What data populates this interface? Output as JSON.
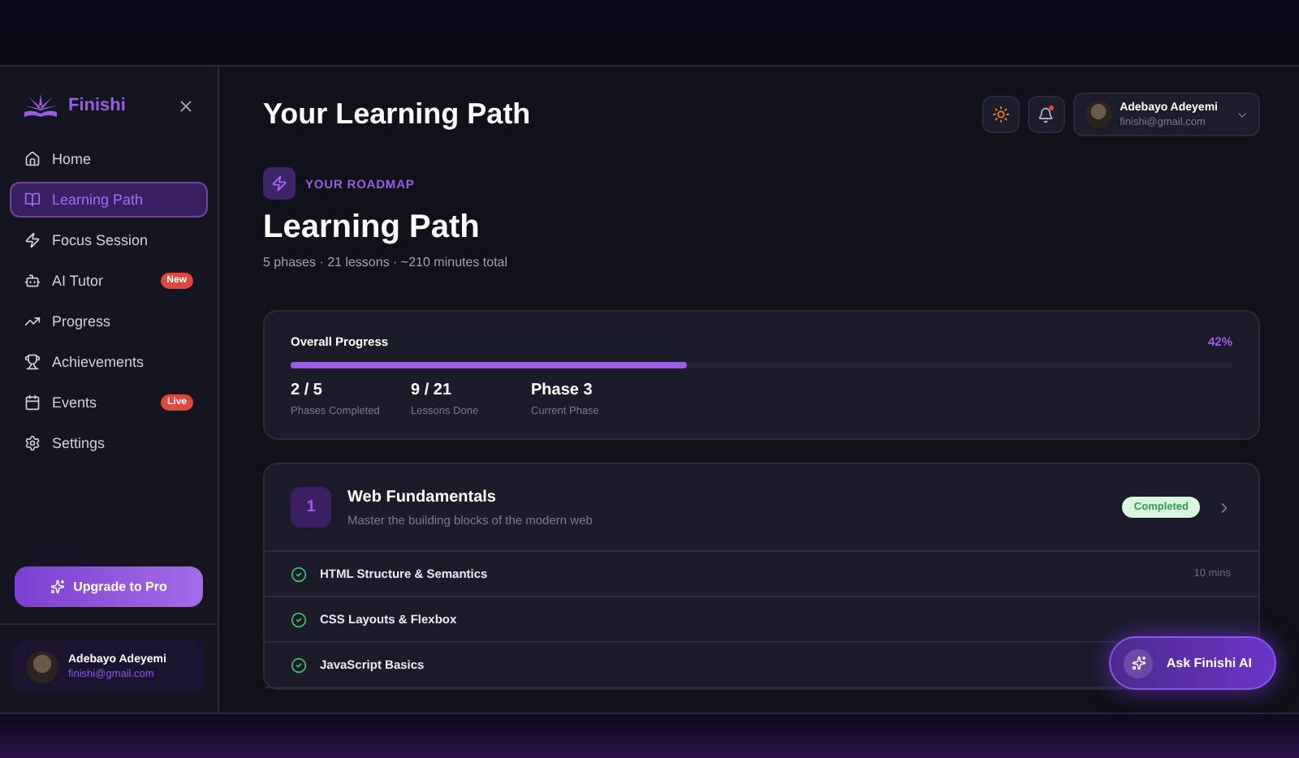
{
  "sidebar": {
    "brand": "Finishi",
    "items": [
      {
        "label": "Home",
        "selected": false
      },
      {
        "label": "Learning Path",
        "selected": true
      },
      {
        "label": "Focus Session",
        "selected": false
      },
      {
        "label": "AI Tutor",
        "selected": false,
        "badge": "New"
      },
      {
        "label": "Progress",
        "selected": false
      },
      {
        "label": "Achievements",
        "selected": false
      },
      {
        "label": "Events",
        "selected": false,
        "badge": "Live"
      },
      {
        "label": "Settings",
        "selected": false
      }
    ],
    "upgrade": "Upgrade to Pro",
    "user": {
      "name": "Adebayo Adeyemi",
      "email": "finishi@gmail.com"
    }
  },
  "header": {
    "title": "Your Learning Path",
    "notification_dot": true,
    "user": {
      "name": "Adebayo Adeyemi",
      "email": "finishi@gmail.com"
    }
  },
  "roadmap": {
    "eyebrow": "YOUR ROADMAP",
    "title": "Learning Path",
    "summary": "5 phases · 21 lessons · ~210 minutes total"
  },
  "progress": {
    "label": "Overall Progress",
    "percent": "42%",
    "level": 0.42,
    "stats": [
      {
        "value": "2 / 5",
        "label": "Phases Completed"
      },
      {
        "value": "9 / 21",
        "label": "Lessons Done"
      },
      {
        "value": "Phase 3",
        "label": "Current Phase"
      }
    ]
  },
  "phase": {
    "number": "1",
    "title": "Web Fundamentals",
    "subtitle": "Master the building blocks of the modern web",
    "status": "Completed",
    "lessons": [
      {
        "title": "HTML Structure & Semantics",
        "duration": "10 mins",
        "checked": true
      },
      {
        "title": "CSS Layouts & Flexbox",
        "checked": true
      },
      {
        "title": "JavaScript Basics",
        "checked": true
      }
    ]
  },
  "ask_button": "Ask Finishi AI"
}
